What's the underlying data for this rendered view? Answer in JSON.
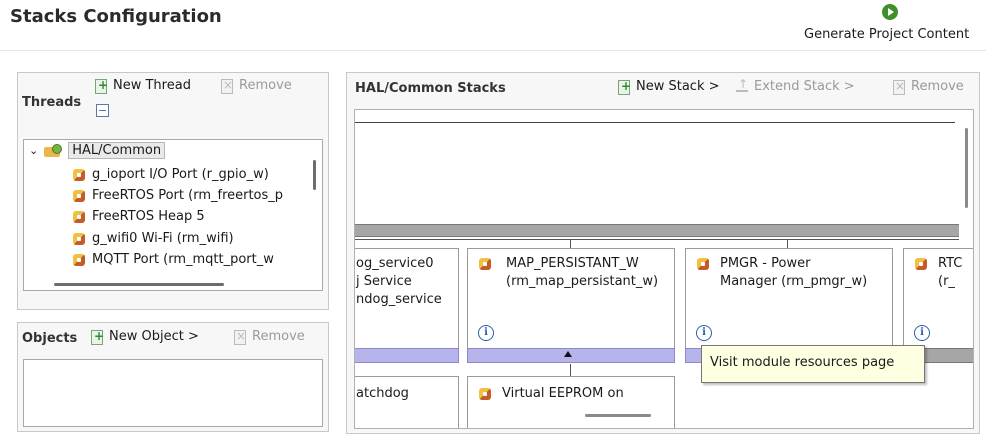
{
  "title": "Stacks Configuration",
  "generate_button": {
    "label": "Generate Project Content"
  },
  "threads": {
    "heading": "Threads",
    "new_thread": "New Thread",
    "remove": "Remove",
    "tree": {
      "root": "HAL/Common",
      "items": [
        "g_ioport I/O Port (r_gpio_w)",
        "FreeRTOS Port (rm_freertos_p",
        "FreeRTOS Heap 5",
        "g_wifi0  Wi-Fi (rm_wifi)",
        "MQTT Port (rm_mqtt_port_w"
      ]
    }
  },
  "objects": {
    "heading": "Objects",
    "new_object": "New Object >",
    "remove": "Remove"
  },
  "stacks": {
    "heading": "HAL/Common Stacks",
    "new_stack": "New Stack >",
    "extend_stack": "Extend Stack >",
    "remove": "Remove",
    "modules": [
      {
        "line1": "og_service0",
        "line2": "j Service",
        "line3": "ndog_service"
      },
      {
        "line1": "MAP_PERSISTANT_W",
        "line2": "(rm_map_persistant_w)"
      },
      {
        "line1": "PMGR - Power",
        "line2": "Manager (rm_pmgr_w)"
      },
      {
        "line1": "RTC",
        "line2": "(r_"
      }
    ],
    "lower_modules": [
      {
        "line1": "atchdog"
      },
      {
        "line1": "Virtual EEPROM on"
      }
    ],
    "tooltip": "Visit module resources page"
  }
}
